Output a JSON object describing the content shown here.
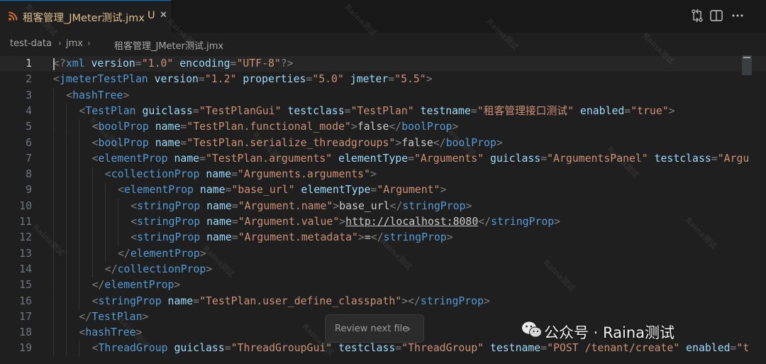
{
  "tab": {
    "title": "租客管理_JMeter测试.jmx",
    "status": "U",
    "close": "✕"
  },
  "breadcrumb": [
    "test-data",
    "jmx",
    "租客管理_JMeter测试.jmx"
  ],
  "editor": {
    "current_line": 1,
    "lines": [
      {
        "n": "1",
        "indent": 0,
        "t": [
          [
            "punc",
            "<?"
          ],
          [
            "tag",
            "xml"
          ],
          [
            "text",
            " "
          ],
          [
            "attr",
            "version"
          ],
          [
            "punc",
            "="
          ],
          [
            "str",
            "\"1.0\""
          ],
          [
            "text",
            " "
          ],
          [
            "attr",
            "encoding"
          ],
          [
            "punc",
            "="
          ],
          [
            "str",
            "\"UTF-8\""
          ],
          [
            "punc",
            "?>"
          ]
        ]
      },
      {
        "n": "2",
        "indent": 0,
        "t": [
          [
            "punc",
            "<"
          ],
          [
            "tag",
            "jmeterTestPlan"
          ],
          [
            "text",
            " "
          ],
          [
            "attr",
            "version"
          ],
          [
            "punc",
            "="
          ],
          [
            "str",
            "\"1.2\""
          ],
          [
            "text",
            " "
          ],
          [
            "attr",
            "properties"
          ],
          [
            "punc",
            "="
          ],
          [
            "str",
            "\"5.0\""
          ],
          [
            "text",
            " "
          ],
          [
            "attr",
            "jmeter"
          ],
          [
            "punc",
            "="
          ],
          [
            "str",
            "\"5.5\""
          ],
          [
            "punc",
            ">"
          ]
        ]
      },
      {
        "n": "3",
        "indent": 1,
        "t": [
          [
            "punc",
            "<"
          ],
          [
            "tag",
            "hashTree"
          ],
          [
            "punc",
            ">"
          ]
        ]
      },
      {
        "n": "4",
        "indent": 2,
        "t": [
          [
            "punc",
            "<"
          ],
          [
            "tag",
            "TestPlan"
          ],
          [
            "text",
            " "
          ],
          [
            "attr",
            "guiclass"
          ],
          [
            "punc",
            "="
          ],
          [
            "str",
            "\"TestPlanGui\""
          ],
          [
            "text",
            " "
          ],
          [
            "attr",
            "testclass"
          ],
          [
            "punc",
            "="
          ],
          [
            "str",
            "\"TestPlan\""
          ],
          [
            "text",
            " "
          ],
          [
            "attr",
            "testname"
          ],
          [
            "punc",
            "="
          ],
          [
            "str",
            "\"租客管理接口测试\""
          ],
          [
            "text",
            " "
          ],
          [
            "attr",
            "enabled"
          ],
          [
            "punc",
            "="
          ],
          [
            "str",
            "\"true\""
          ],
          [
            "punc",
            ">"
          ]
        ]
      },
      {
        "n": "5",
        "indent": 3,
        "t": [
          [
            "punc",
            "<"
          ],
          [
            "tag",
            "boolProp"
          ],
          [
            "text",
            " "
          ],
          [
            "attr",
            "name"
          ],
          [
            "punc",
            "="
          ],
          [
            "str",
            "\"TestPlan.functional_mode\""
          ],
          [
            "punc",
            ">"
          ],
          [
            "text",
            "false"
          ],
          [
            "punc",
            "</"
          ],
          [
            "tag",
            "boolProp"
          ],
          [
            "punc",
            ">"
          ]
        ]
      },
      {
        "n": "6",
        "indent": 3,
        "t": [
          [
            "punc",
            "<"
          ],
          [
            "tag",
            "boolProp"
          ],
          [
            "text",
            " "
          ],
          [
            "attr",
            "name"
          ],
          [
            "punc",
            "="
          ],
          [
            "str",
            "\"TestPlan.serialize_threadgroups\""
          ],
          [
            "punc",
            ">"
          ],
          [
            "text",
            "false"
          ],
          [
            "punc",
            "</"
          ],
          [
            "tag",
            "boolProp"
          ],
          [
            "punc",
            ">"
          ]
        ]
      },
      {
        "n": "7",
        "indent": 3,
        "t": [
          [
            "punc",
            "<"
          ],
          [
            "tag",
            "elementProp"
          ],
          [
            "text",
            " "
          ],
          [
            "attr",
            "name"
          ],
          [
            "punc",
            "="
          ],
          [
            "str",
            "\"TestPlan.arguments\""
          ],
          [
            "text",
            " "
          ],
          [
            "attr",
            "elementType"
          ],
          [
            "punc",
            "="
          ],
          [
            "str",
            "\"Arguments\""
          ],
          [
            "text",
            " "
          ],
          [
            "attr",
            "guiclass"
          ],
          [
            "punc",
            "="
          ],
          [
            "str",
            "\"ArgumentsPanel\""
          ],
          [
            "text",
            " "
          ],
          [
            "attr",
            "testclass"
          ],
          [
            "punc",
            "="
          ],
          [
            "str",
            "\"Argu"
          ]
        ]
      },
      {
        "n": "8",
        "indent": 4,
        "t": [
          [
            "punc",
            "<"
          ],
          [
            "tag",
            "collectionProp"
          ],
          [
            "text",
            " "
          ],
          [
            "attr",
            "name"
          ],
          [
            "punc",
            "="
          ],
          [
            "str",
            "\"Arguments.arguments\""
          ],
          [
            "punc",
            ">"
          ]
        ]
      },
      {
        "n": "9",
        "indent": 5,
        "t": [
          [
            "punc",
            "<"
          ],
          [
            "tag",
            "elementProp"
          ],
          [
            "text",
            " "
          ],
          [
            "attr",
            "name"
          ],
          [
            "punc",
            "="
          ],
          [
            "str",
            "\"base_url\""
          ],
          [
            "text",
            " "
          ],
          [
            "attr",
            "elementType"
          ],
          [
            "punc",
            "="
          ],
          [
            "str",
            "\"Argument\""
          ],
          [
            "punc",
            ">"
          ]
        ]
      },
      {
        "n": "10",
        "indent": 6,
        "t": [
          [
            "punc",
            "<"
          ],
          [
            "tag",
            "stringProp"
          ],
          [
            "text",
            " "
          ],
          [
            "attr",
            "name"
          ],
          [
            "punc",
            "="
          ],
          [
            "str",
            "\"Argument.name\""
          ],
          [
            "punc",
            ">"
          ],
          [
            "text",
            "base_url"
          ],
          [
            "punc",
            "</"
          ],
          [
            "tag",
            "stringProp"
          ],
          [
            "punc",
            ">"
          ]
        ]
      },
      {
        "n": "11",
        "indent": 6,
        "t": [
          [
            "punc",
            "<"
          ],
          [
            "tag",
            "stringProp"
          ],
          [
            "text",
            " "
          ],
          [
            "attr",
            "name"
          ],
          [
            "punc",
            "="
          ],
          [
            "str",
            "\"Argument.value\""
          ],
          [
            "punc",
            ">"
          ],
          [
            "link",
            "http://localhost:8080"
          ],
          [
            "punc",
            "</"
          ],
          [
            "tag",
            "stringProp"
          ],
          [
            "punc",
            ">"
          ]
        ]
      },
      {
        "n": "12",
        "indent": 6,
        "t": [
          [
            "punc",
            "<"
          ],
          [
            "tag",
            "stringProp"
          ],
          [
            "text",
            " "
          ],
          [
            "attr",
            "name"
          ],
          [
            "punc",
            "="
          ],
          [
            "str",
            "\"Argument.metadata\""
          ],
          [
            "punc",
            ">"
          ],
          [
            "text",
            "="
          ],
          [
            "punc",
            "</"
          ],
          [
            "tag",
            "stringProp"
          ],
          [
            "punc",
            ">"
          ]
        ]
      },
      {
        "n": "13",
        "indent": 5,
        "t": [
          [
            "punc",
            "</"
          ],
          [
            "tag",
            "elementProp"
          ],
          [
            "punc",
            ">"
          ]
        ]
      },
      {
        "n": "14",
        "indent": 4,
        "t": [
          [
            "punc",
            "</"
          ],
          [
            "tag",
            "collectionProp"
          ],
          [
            "punc",
            ">"
          ]
        ]
      },
      {
        "n": "15",
        "indent": 3,
        "t": [
          [
            "punc",
            "</"
          ],
          [
            "tag",
            "elementProp"
          ],
          [
            "punc",
            ">"
          ]
        ]
      },
      {
        "n": "16",
        "indent": 3,
        "t": [
          [
            "punc",
            "<"
          ],
          [
            "tag",
            "stringProp"
          ],
          [
            "text",
            " "
          ],
          [
            "attr",
            "name"
          ],
          [
            "punc",
            "="
          ],
          [
            "str",
            "\"TestPlan.user_define_classpath\""
          ],
          [
            "punc",
            "></"
          ],
          [
            "tag",
            "stringProp"
          ],
          [
            "punc",
            ">"
          ]
        ]
      },
      {
        "n": "17",
        "indent": 2,
        "t": [
          [
            "punc",
            "</"
          ],
          [
            "tag",
            "TestPlan"
          ],
          [
            "punc",
            ">"
          ]
        ]
      },
      {
        "n": "18",
        "indent": 2,
        "t": [
          [
            "punc",
            "<"
          ],
          [
            "tag",
            "hashTree"
          ],
          [
            "punc",
            ">"
          ]
        ]
      },
      {
        "n": "19",
        "indent": 3,
        "t": [
          [
            "punc",
            "<"
          ],
          [
            "tag",
            "ThreadGroup"
          ],
          [
            "text",
            " "
          ],
          [
            "attr",
            "guiclass"
          ],
          [
            "punc",
            "="
          ],
          [
            "str",
            "\"ThreadGroupGui\""
          ],
          [
            "text",
            " "
          ],
          [
            "attr",
            "testclass"
          ],
          [
            "punc",
            "="
          ],
          [
            "str",
            "\"ThreadGroup\""
          ],
          [
            "text",
            " "
          ],
          [
            "attr",
            "testname"
          ],
          [
            "punc",
            "="
          ],
          [
            "str",
            "\"POST /tenant/create\""
          ],
          [
            "text",
            " "
          ],
          [
            "attr",
            "enabled"
          ],
          [
            "punc",
            "="
          ],
          [
            "str",
            "\"t"
          ]
        ]
      }
    ]
  },
  "review_button": {
    "label": "Review next file",
    "chevron": "›"
  },
  "watermark": {
    "text": "Raina测试"
  },
  "attribution": {
    "text": "公众号 · Raina测试"
  },
  "colors": {
    "accent": "#0078d4",
    "modified": "#e2c08d",
    "tag": "#569cd6",
    "attr": "#9cdcfe",
    "string": "#ce9178"
  },
  "icons": {
    "tab": "rss-xml-file-icon",
    "compare": "compare-changes-icon",
    "split": "split-editor-icon",
    "more": "more-actions-icon"
  }
}
